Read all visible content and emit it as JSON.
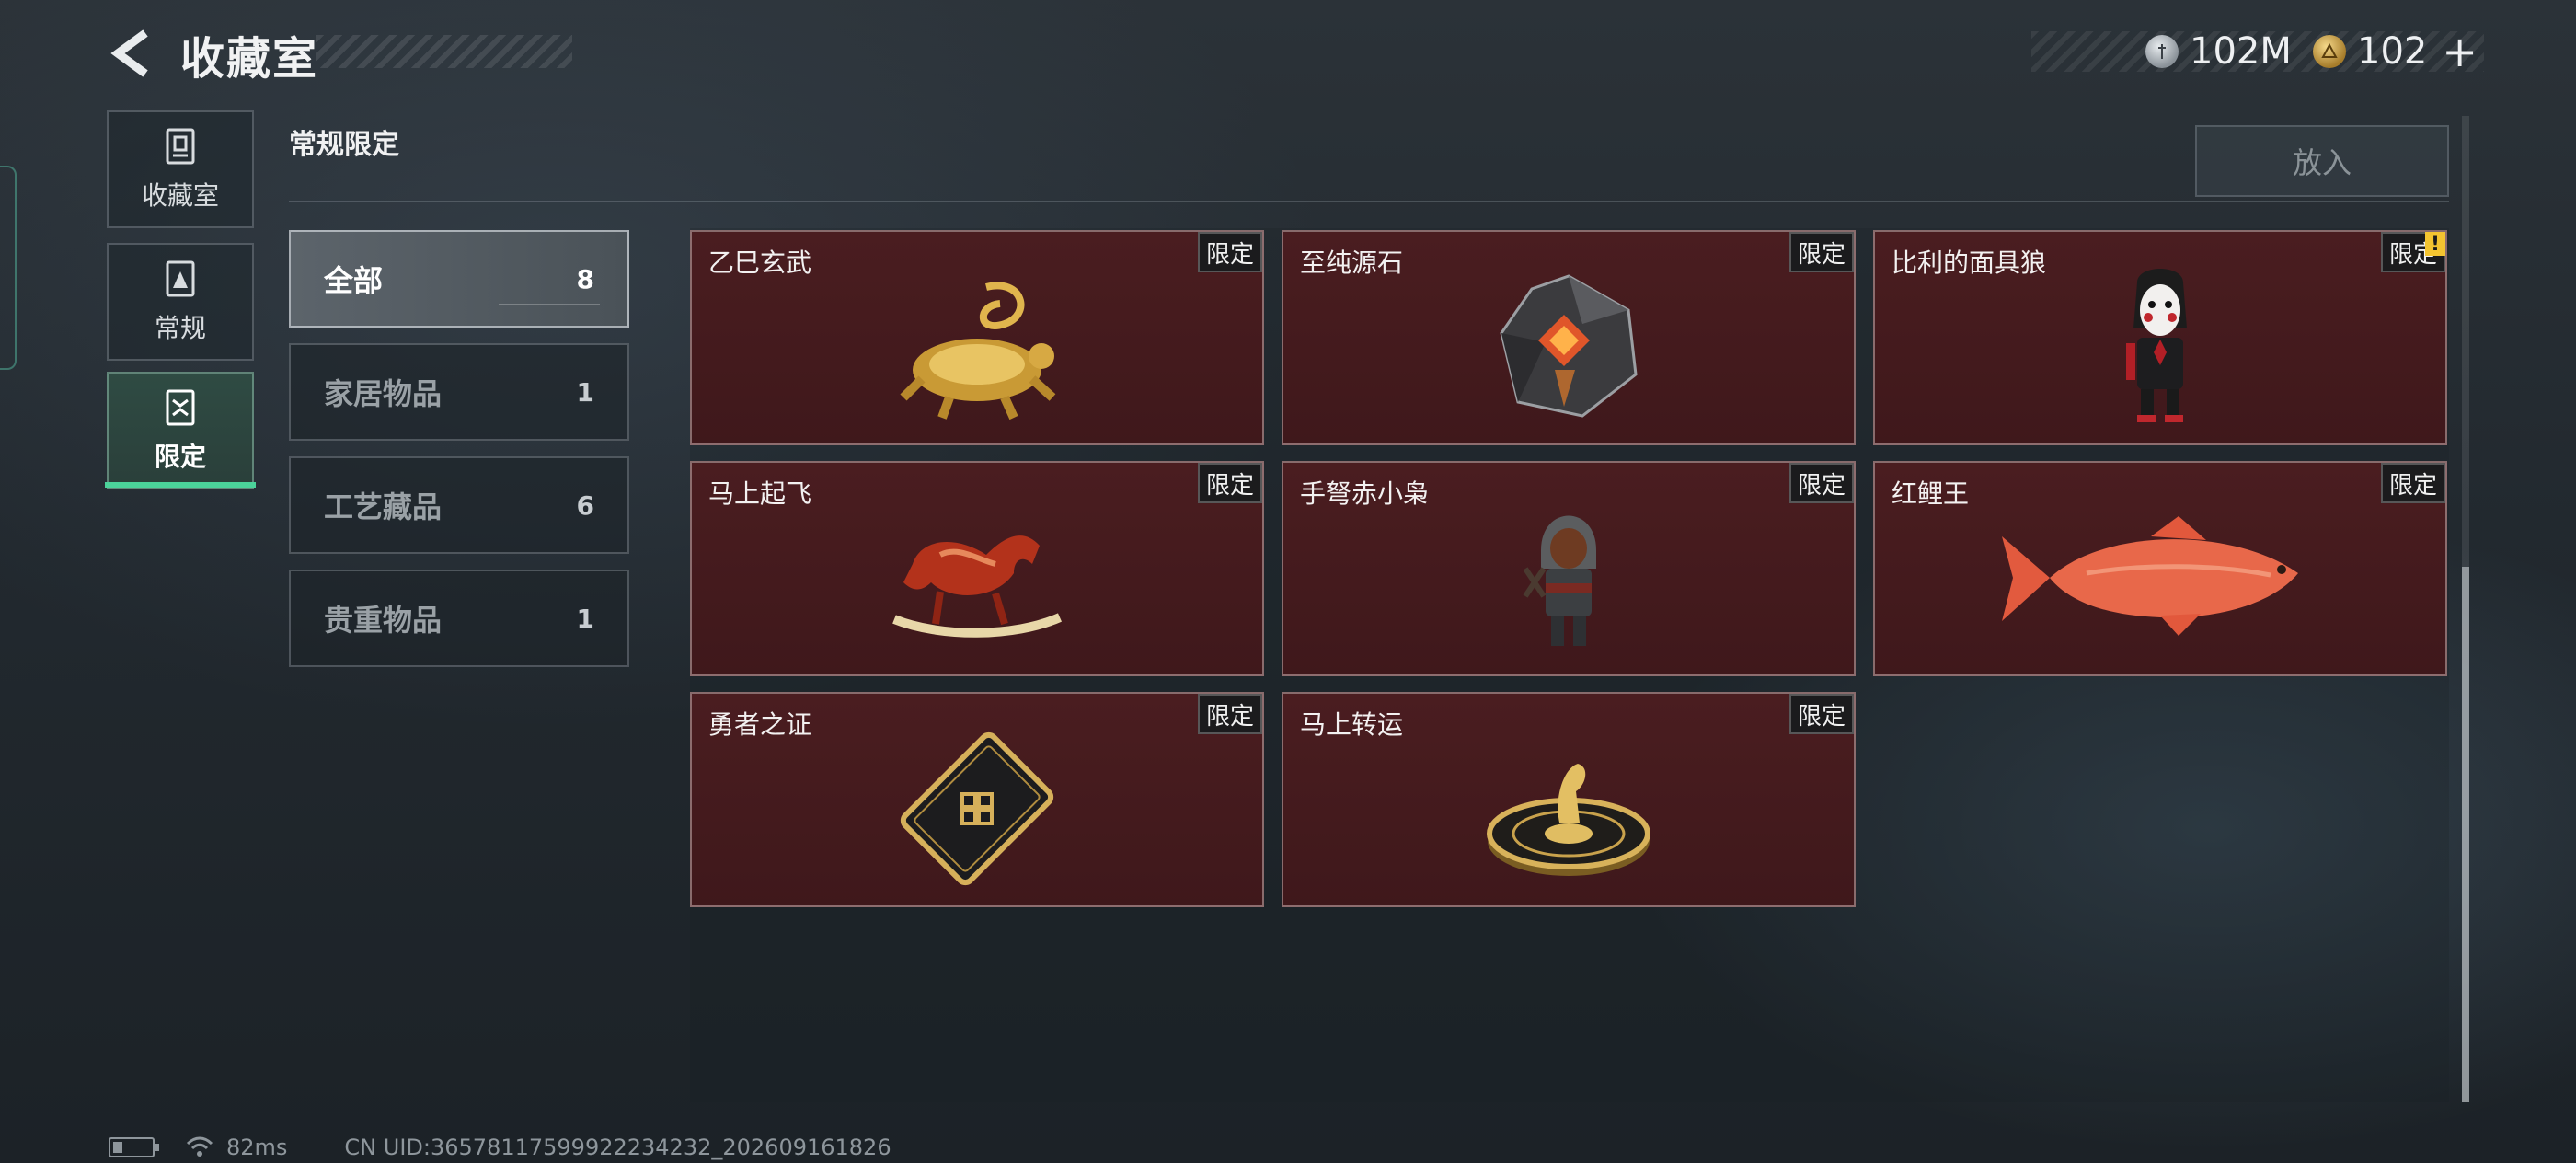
{
  "header": {
    "title": "收藏室",
    "currency": [
      {
        "icon": "silver-coin-icon",
        "amount": "102M"
      },
      {
        "icon": "gold-coin-icon",
        "amount": "102"
      }
    ]
  },
  "nav": {
    "items": [
      {
        "label": "收藏室",
        "icon": "collection-room-icon"
      },
      {
        "label": "常规",
        "icon": "regular-icon"
      },
      {
        "label": "限定",
        "icon": "limited-icon",
        "active": true
      }
    ]
  },
  "section": {
    "title": "常规限定",
    "place_button": "放入"
  },
  "categories": [
    {
      "name": "全部",
      "count": "8",
      "active": true
    },
    {
      "name": "家居物品",
      "count": "1"
    },
    {
      "name": "工艺藏品",
      "count": "6"
    },
    {
      "name": "贵重物品",
      "count": "1"
    }
  ],
  "items": [
    {
      "name": "乙巳玄武",
      "badge": "限定",
      "icon": "golden-snake-turtle-icon"
    },
    {
      "name": "至纯源石",
      "badge": "限定",
      "icon": "crystal-stone-icon"
    },
    {
      "name": "比利的面具狼",
      "badge": "限定",
      "icon": "puppet-doll-icon",
      "new_marker": "!"
    },
    {
      "name": "马上起飞",
      "badge": "限定",
      "icon": "red-horse-icon"
    },
    {
      "name": "手弩赤小枭",
      "badge": "限定",
      "icon": "hooded-figure-icon"
    },
    {
      "name": "红鲤王",
      "badge": "限定",
      "icon": "red-carp-icon"
    },
    {
      "name": "勇者之证",
      "badge": "限定",
      "icon": "hero-card-icon"
    },
    {
      "name": "马上转运",
      "badge": "限定",
      "icon": "horse-dial-icon"
    }
  ],
  "footer": {
    "ping": "82ms",
    "uid": "CN UID:3657811759992223423​2_202609161826"
  },
  "colors": {
    "accent": "#4bd39a",
    "card_bg": "#4a1d20",
    "gold": "#d4a84a"
  }
}
